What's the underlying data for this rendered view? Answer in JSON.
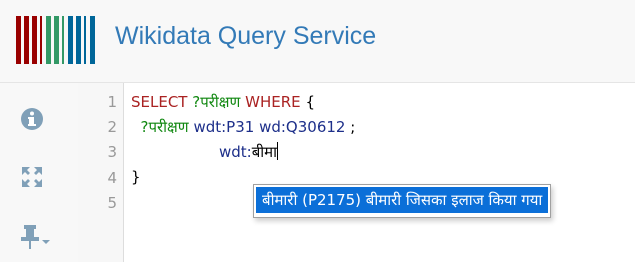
{
  "header": {
    "title": "Wikidata Query Service",
    "logo_colors": [
      "#990000",
      "#339966",
      "#006699"
    ]
  },
  "toolbar": {
    "items": [
      {
        "name": "info-icon",
        "color": "#80a0b8"
      },
      {
        "name": "fullscreen-icon",
        "color": "#80a0b8"
      },
      {
        "name": "pin-icon",
        "color": "#80a0b8"
      }
    ]
  },
  "editor": {
    "line_numbers": [
      "1",
      "2",
      "3",
      "4",
      "5"
    ],
    "lines": {
      "l1": {
        "kw1": "SELECT",
        "var": "?परीक्षण",
        "kw2": "WHERE",
        "brace": "{"
      },
      "l2": {
        "var": "?परीक्षण",
        "p1": "wdt:P31",
        "p2": "wd:Q30612",
        "sep": ";"
      },
      "l3": {
        "prefix": "wdt:",
        "typed": "बीमा"
      },
      "l4": {
        "brace": "}"
      }
    },
    "autocomplete": {
      "selected": "बीमारी (P2175) बीमारी जिसका इलाज किया गया"
    }
  }
}
